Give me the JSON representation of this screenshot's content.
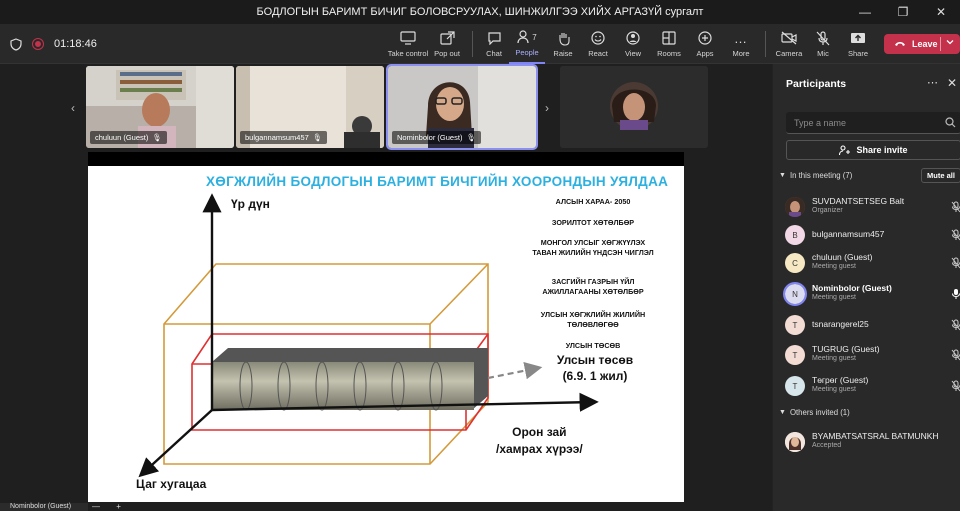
{
  "window": {
    "title": "БОДЛОГЫН БАРИМТ БИЧИГ БОЛОВСРУУЛАХ, ШИНЖИЛГЭЭ ХИЙХ АРГАЗҮЙ сургалт"
  },
  "toolbar": {
    "timer": "01:18:46",
    "items": [
      {
        "label": "Take control",
        "icon": "take-control-icon"
      },
      {
        "label": "Pop out",
        "icon": "pop-out-icon"
      },
      {
        "label": "Chat",
        "icon": "chat-icon"
      },
      {
        "label": "People",
        "icon": "people-icon",
        "count": "7"
      },
      {
        "label": "Raise",
        "icon": "raise-hand-icon"
      },
      {
        "label": "React",
        "icon": "react-icon"
      },
      {
        "label": "View",
        "icon": "view-icon"
      },
      {
        "label": "Rooms",
        "icon": "rooms-icon"
      },
      {
        "label": "Apps",
        "icon": "apps-icon"
      },
      {
        "label": "More",
        "icon": "more-icon"
      },
      {
        "label": "Camera",
        "icon": "camera-off-icon"
      },
      {
        "label": "Mic",
        "icon": "mic-off-icon"
      },
      {
        "label": "Share",
        "icon": "share-icon"
      }
    ],
    "leave": "Leave"
  },
  "video_tiles": [
    {
      "name": "chuluun (Guest)"
    },
    {
      "name": "bulgannamsum457"
    },
    {
      "name": "Nominbolor (Guest)"
    },
    {
      "name": ""
    }
  ],
  "slide": {
    "title": "ХӨГЖЛИЙН БОДЛОГЫН БАРИМТ БИЧГИЙН ХООРОНДЫН УЯЛДАА",
    "y_axis": "Үр дүн",
    "x_axis": "Цаг хугацаа",
    "z_axis_line1": "Орон зай",
    "z_axis_line2": "/хамрах хүрээ/",
    "levels": [
      "АЛСЫН ХАРАА- 2050",
      "ЗОРИЛТОТ ХӨТӨЛБӨР",
      "МОНГОЛ УЛСЫГ ХӨГЖҮҮЛЭХ ТАВАН ЖИЛИЙН ҮНДСЭН ЧИГЛЭЛ",
      "ЗАСГИЙН ГАЗРЫН ҮЙЛ АЖИЛЛАГААНЫ ХӨТӨЛБӨР",
      "УЛСЫН ХӨГЖЛИЙН ЖИЛИЙН ТӨЛӨВЛӨГӨӨ",
      "УЛСЫН ТӨСӨВ"
    ],
    "budget_line1": "Улсын төсөв",
    "budget_line2": "(6.9.  1 жил)"
  },
  "bottom": {
    "presenter": "Nominbolor (Guest)"
  },
  "panel": {
    "title": "Participants",
    "search_placeholder": "Type a name",
    "share_invite": "Share invite",
    "in_meeting": "In this meeting (7)",
    "mute_all": "Mute all",
    "others_invited": "Others invited (1)",
    "participants": [
      {
        "name": "SUVDANTSETSEG Balt",
        "role": "Organizer",
        "initial": "",
        "color": "#7a5a4a"
      },
      {
        "name": "bulgannamsum457",
        "role": "",
        "initial": "B",
        "color": "#f2d7e6"
      },
      {
        "name": "chuluun (Guest)",
        "role": "Meeting guest",
        "initial": "C",
        "color": "#f7e8c4"
      },
      {
        "name": "Nominbolor (Guest)",
        "role": "Meeting guest",
        "initial": "N",
        "color": "#dcdcf0"
      },
      {
        "name": "tsnarangerel25",
        "role": "",
        "initial": "T",
        "color": "#f3dcd3"
      },
      {
        "name": "TUGRUG (Guest)",
        "role": "Meeting guest",
        "initial": "T",
        "color": "#f3dcd3"
      },
      {
        "name": "Tөгрөг (Guest)",
        "role": "Meeting guest",
        "initial": "T",
        "color": "#d6e6ea"
      }
    ],
    "invited": [
      {
        "name": "BYAMBATSATSRAL BATMUNKH",
        "status": "Accepted"
      }
    ]
  }
}
